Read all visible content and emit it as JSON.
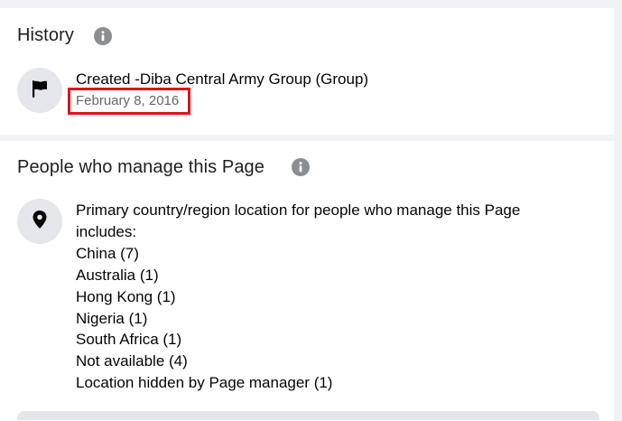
{
  "history": {
    "title": "History",
    "created_text": "Created -Diba Central Army Group (Group)",
    "created_date": "February 8, 2016"
  },
  "managers": {
    "title": "People who manage this Page",
    "intro_line1": "Primary country/region location for people who manage this Page",
    "intro_line2": "includes:",
    "locations": [
      "China (7)",
      "Australia (1)",
      "Hong Kong (1)",
      "Nigeria (1)",
      "South Africa (1)",
      "Not available (4)",
      "Location hidden by Page manager (1)"
    ]
  },
  "colors": {
    "highlight_box": "#e0121b",
    "info_icon": "#8a8d91",
    "icon_bg": "#e4e6eb",
    "page_bg": "#f0f2f5"
  },
  "icons": {
    "history_info": "info-icon",
    "history_item": "flag-icon",
    "managers_info": "info-icon",
    "managers_item": "location-pin-icon"
  }
}
